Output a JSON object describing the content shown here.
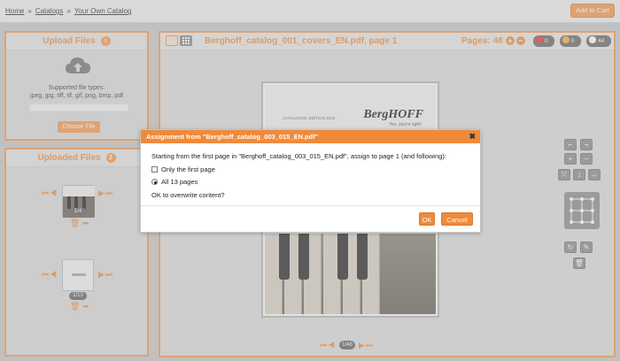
{
  "breadcrumb": {
    "home": "Home",
    "catalogs": "Catalogs",
    "current": "Your Own Catalog"
  },
  "topbar": {
    "add_to_cart": "Add to Cart"
  },
  "upload_panel": {
    "title": "Upload Files",
    "info_icon": "info-icon",
    "supported_label": "Supported file types:",
    "types": "jpeg, jpg, tiff, tif, gif, png, bmp, pdf",
    "choose_file": "Choose File"
  },
  "uploaded_panel": {
    "title": "Uploaded Files",
    "count": "2",
    "files": [
      {
        "counter": "1/4"
      },
      {
        "counter": "1/13"
      }
    ]
  },
  "main": {
    "title": "Berghoff_catalog_001_covers_EN.pdf, page 1",
    "pages_label": "Pages: 48",
    "stats": [
      {
        "icon": "error-icon",
        "value": "0",
        "color": "#e23b3b"
      },
      {
        "icon": "warning-icon",
        "value": "0",
        "color": "#f2b233"
      },
      {
        "icon": "image-icon",
        "value": "44",
        "color": "#ffffff"
      }
    ],
    "page_counter": "1/48",
    "preview": {
      "brand": "BergHOFF",
      "tagline": "Yes, you're right!",
      "edition": "CATALOGUE: EDITION 2018"
    }
  },
  "dialog": {
    "title": "Assignment from \"Berghoff_catalog_003_015_EN.pdf\"",
    "close": "✖",
    "prompt": "Starting from the first page in \"Berghoff_catalog_003_015_EN.pdf\", assign to page 1 (and following):",
    "option_first": "Only the first page",
    "option_all": "All 13 pages",
    "confirm": "OK to overwrite content?",
    "ok": "OK",
    "cancel": "Cancel"
  },
  "colors": {
    "accent": "#ef8f42",
    "panel_bg": "#e4e4e4",
    "dialog_header": "#ef8a3b"
  }
}
